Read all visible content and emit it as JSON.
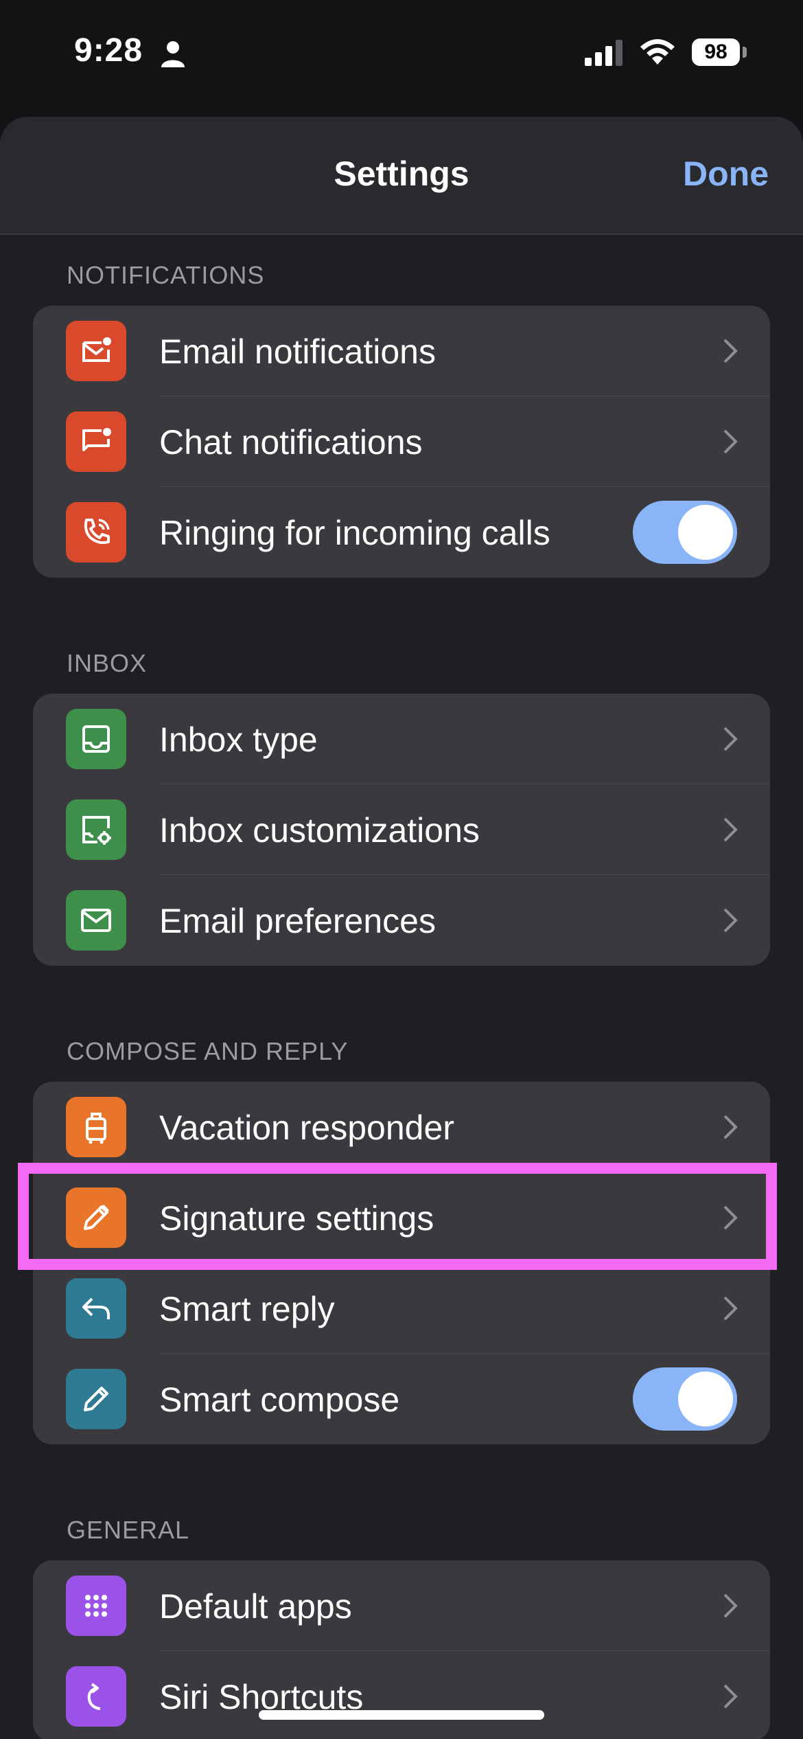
{
  "status_bar": {
    "time": "9:28",
    "battery": "98",
    "icons": [
      "person-icon",
      "signal-icon",
      "wifi-icon",
      "battery-icon"
    ]
  },
  "nav": {
    "title": "Settings",
    "done_label": "Done"
  },
  "sections": {
    "notifications": {
      "header": "NOTIFICATIONS",
      "items": [
        {
          "label": "Email notifications",
          "icon": "mail-notification-icon",
          "control": "chevron"
        },
        {
          "label": "Chat notifications",
          "icon": "chat-notification-icon",
          "control": "chevron"
        },
        {
          "label": "Ringing for incoming calls",
          "icon": "phone-ringing-icon",
          "control": "toggle",
          "on": true
        }
      ]
    },
    "inbox": {
      "header": "INBOX",
      "items": [
        {
          "label": "Inbox type",
          "icon": "inbox-icon",
          "control": "chevron"
        },
        {
          "label": "Inbox customizations",
          "icon": "inbox-settings-icon",
          "control": "chevron"
        },
        {
          "label": "Email preferences",
          "icon": "envelope-icon",
          "control": "chevron"
        }
      ]
    },
    "compose": {
      "header": "COMPOSE AND REPLY",
      "items": [
        {
          "label": "Vacation responder",
          "icon": "suitcase-icon",
          "control": "chevron"
        },
        {
          "label": "Signature settings",
          "icon": "signature-pen-icon",
          "control": "chevron"
        },
        {
          "label": "Smart reply",
          "icon": "reply-arrow-icon",
          "control": "chevron"
        },
        {
          "label": "Smart compose",
          "icon": "pencil-icon",
          "control": "toggle",
          "on": true
        }
      ]
    },
    "general": {
      "header": "GENERAL",
      "items": [
        {
          "label": "Default apps",
          "icon": "apps-grid-icon",
          "control": "chevron"
        },
        {
          "label": "Siri Shortcuts",
          "icon": "siri-shortcut-icon",
          "control": "chevron"
        }
      ]
    }
  },
  "colors": {
    "accent": "#8ab4f8",
    "highlight": "#f56af2",
    "red_icon": "#d9492c",
    "green_icon": "#3f8f4c",
    "orange_icon": "#e8752a",
    "teal_icon": "#2e7a92",
    "purple_icon": "#9b52e8"
  }
}
